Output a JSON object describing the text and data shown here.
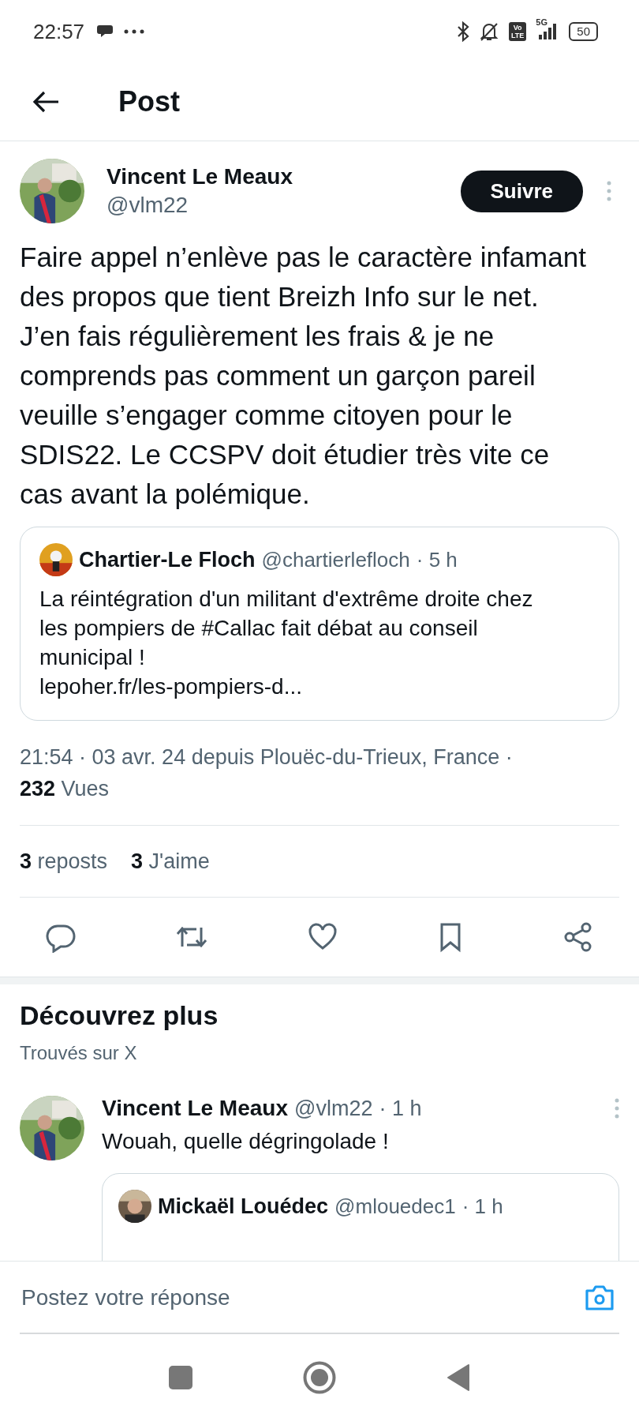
{
  "status_bar": {
    "time": "22:57",
    "battery": "50",
    "network": "5G",
    "volte": [
      "Vo",
      "LTE"
    ]
  },
  "header": {
    "title": "Post"
  },
  "post": {
    "author": "Vincent Le Meaux",
    "handle": "@vlm22",
    "follow_button": "Suivre",
    "text": "Faire appel n’enlève pas le caractère infamant des propos que tient Breizh Info sur le net. J’en fais régulièrement les frais & je ne comprends pas comment un garçon pareil veuille s’engager comme citoyen pour le SDIS22. Le CCSPV doit étudier très vite ce cas avant la polémique.",
    "quote": {
      "author": "Chartier-Le Floch",
      "handle": "@chartierlefloch",
      "time": "· 5 h",
      "text": "La réintégration d'un militant d'extrême droite chez les pompiers de #Callac fait débat au conseil municipal !",
      "link": "lepoher.fr/les-pompiers-d..."
    },
    "meta": "21:54 · 03 avr. 24 depuis Plouëc-du-Trieux, France ·",
    "views_count": "232",
    "views_label": "Vues",
    "stats": [
      {
        "count": "3",
        "label": "reposts"
      },
      {
        "count": "3",
        "label": "J'aime"
      }
    ],
    "actions": [
      {
        "kind": "reply"
      },
      {
        "kind": "repost"
      },
      {
        "kind": "like"
      },
      {
        "kind": "bookmark"
      },
      {
        "kind": "share"
      }
    ]
  },
  "discover": {
    "title": "Découvrez plus",
    "subtitle": "Trouvés sur X",
    "tweets": [
      {
        "author": "Vincent Le Meaux",
        "handle": "@vlm22",
        "time": "· 1 h",
        "text": "Wouah, quelle dégringolade !",
        "quote": {
          "author": "Mickaël Louédec",
          "handle": "@mlouedec1",
          "time": "· 1 h"
        }
      }
    ]
  },
  "reply_bar": {
    "placeholder": "Postez votre réponse"
  }
}
